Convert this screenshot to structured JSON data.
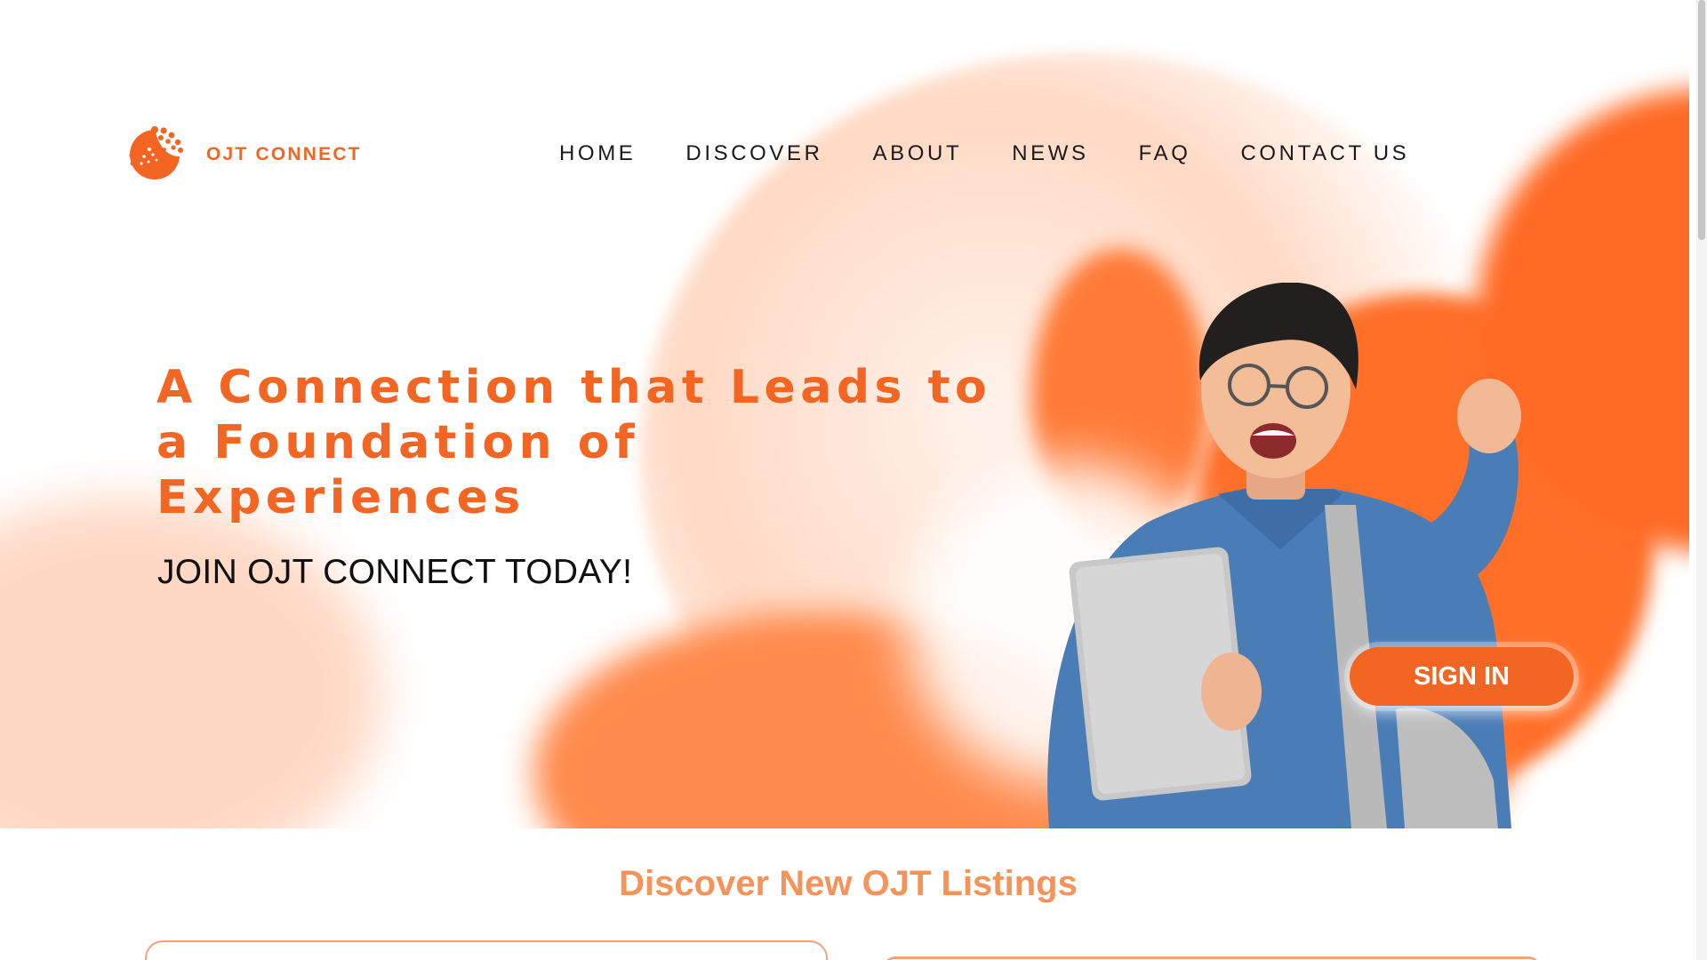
{
  "brand": {
    "logo_icon": "dotted-globe-logo-icon",
    "name": "OJT CONNECT",
    "accent": "#f26522"
  },
  "nav": {
    "items": [
      "HOME",
      "DISCOVER",
      "ABOUT",
      "NEWS",
      "FAQ",
      "CONTACT US"
    ]
  },
  "hero": {
    "headline": "A Connection that Leads to a Foundation of Experiences",
    "subheadline": "JOIN OJT CONNECT TODAY!",
    "signin_label": "SIGN IN"
  },
  "listings": {
    "title": "Discover New OJT Listings"
  }
}
